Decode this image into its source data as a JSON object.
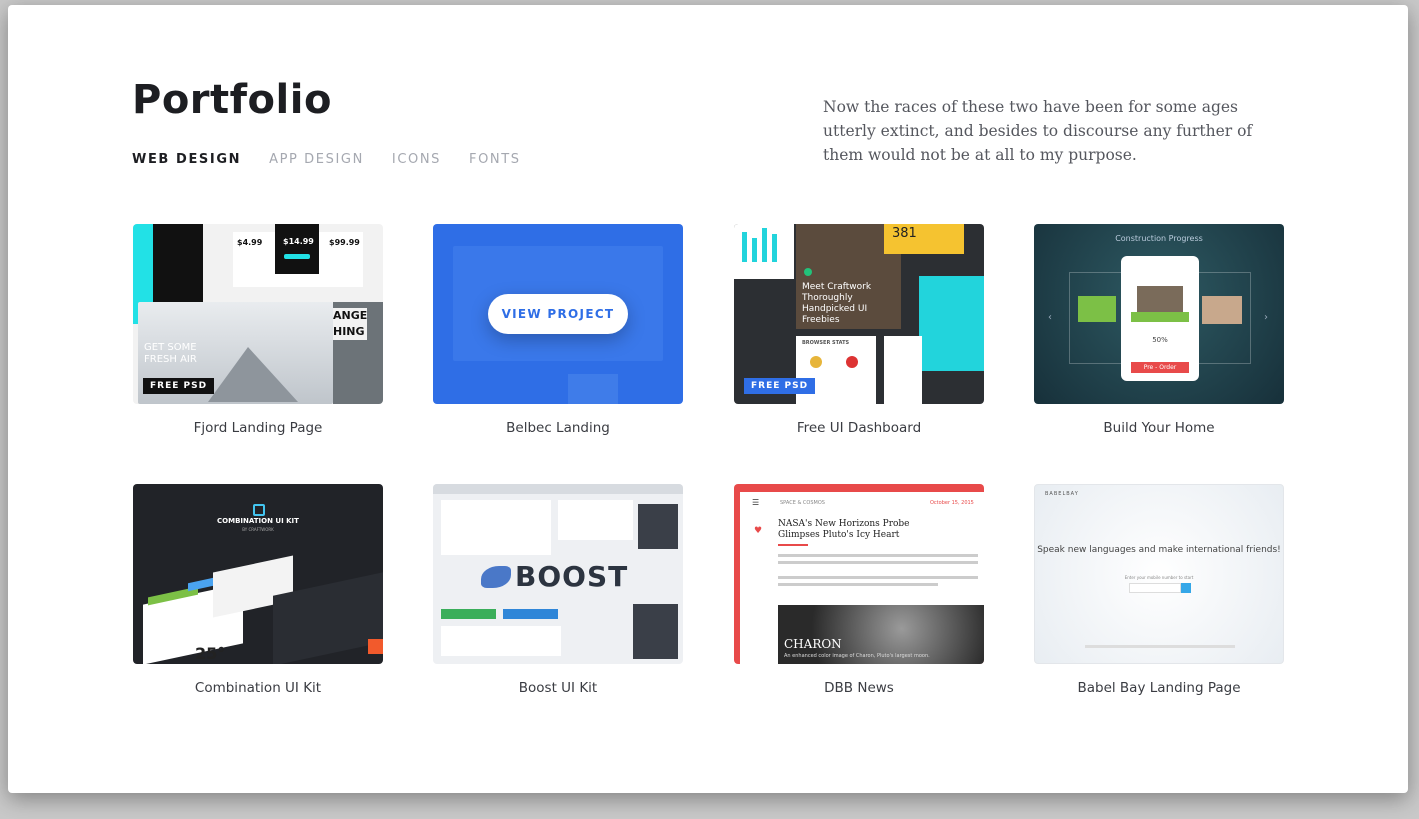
{
  "header": {
    "title": "Portfolio",
    "description": "Now the races of these two have been for some ages utterly extinct, and besides to discourse any further of them would not be at all to my purpose."
  },
  "tabs": [
    {
      "label": "WEB DESIGN",
      "active": true
    },
    {
      "label": "APP DESIGN",
      "active": false
    },
    {
      "label": "ICONS",
      "active": false
    },
    {
      "label": "FONTS",
      "active": false
    }
  ],
  "projects": [
    {
      "title": "Fjord Landing Page",
      "badge": "FREE PSD",
      "prices": [
        "$4.99",
        "$14.99",
        "$99.99"
      ],
      "hero_text": "GET SOME\nFRESH AIR",
      "side_text": "ANGE\nHING"
    },
    {
      "title": "Belbec Landing",
      "button": "VIEW PROJECT"
    },
    {
      "title": "Free UI Dashboard",
      "badge": "FREE PSD",
      "headline": "Meet Craftwork Thoroughly Handpicked UI Freebies",
      "counter": "381",
      "stats_label": "BROWSER STATS"
    },
    {
      "title": "Build Your Home",
      "panel_title": "Construction Progress",
      "percent": "50%",
      "order_label": "Pre - Order"
    },
    {
      "title": "Combination UI Kit",
      "kit_title": "COMBINATION UI KIT",
      "kit_sub": "BY CRAFTWORK",
      "temp": "25°"
    },
    {
      "title": "Boost UI Kit",
      "logo_text": "BOOST"
    },
    {
      "title": "DBB News",
      "headline": "NASA's New Horizons Probe Glimpses Pluto's Icy Heart",
      "caption_title": "CHARON",
      "caption_text": "An enhanced color image of Charon, Pluto's largest moon.",
      "section": "SPACE & COSMOS",
      "date": "October 15, 2015"
    },
    {
      "title": "Babel Bay Landing Page",
      "brand": "BABELBAY",
      "headline": "Speak new languages and make international friends!",
      "prompt": "Enter your mobile number to start"
    }
  ],
  "colors": {
    "accent": "#2f6ee6",
    "cyan": "#22e1e6",
    "red": "#e84a4a",
    "dark": "#1d1e22"
  }
}
